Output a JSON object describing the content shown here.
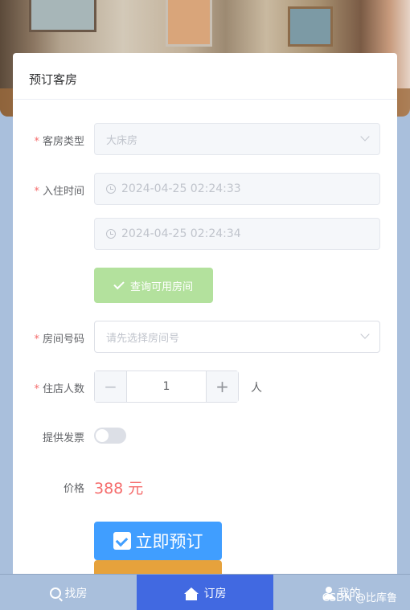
{
  "card": {
    "title": "预订客房"
  },
  "form": {
    "room_type": {
      "label": "客房类型",
      "value": "大床房"
    },
    "checkin": {
      "label": "入住时间",
      "start": "2024-04-25 02:24:33",
      "end": "2024-04-25 02:24:34"
    },
    "query_button": "查询可用房间",
    "room_number": {
      "label": "房间号码",
      "placeholder": "请先选择房间号"
    },
    "guests": {
      "label": "住店人数",
      "value": "1",
      "unit": "人",
      "minus": "−",
      "plus": "+"
    },
    "invoice": {
      "label": "提供发票",
      "on": false
    },
    "price": {
      "label": "价格",
      "value": "388 元"
    },
    "book_button": "立即预订"
  },
  "nav": {
    "items": [
      {
        "label": "找房",
        "icon": "search-icon"
      },
      {
        "label": "订房",
        "icon": "home-icon",
        "active": true
      },
      {
        "label": "我的",
        "icon": "user-icon"
      }
    ]
  },
  "watermark": "CSDN @比库鲁",
  "colors": {
    "primary": "#409eff",
    "success_disabled": "#b3e19d",
    "danger": "#f56c6c",
    "warning": "#e6a23c",
    "nav_active": "#4169e1",
    "nav_bg": "#a9bfdc"
  }
}
